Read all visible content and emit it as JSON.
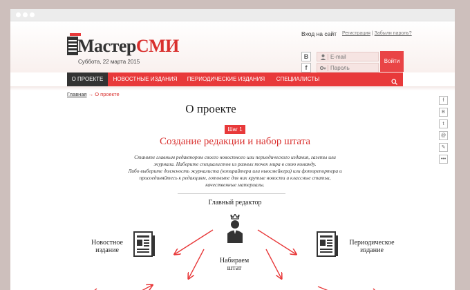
{
  "header": {
    "logo_part1": "Мастер",
    "logo_part2": "СМИ",
    "date": "Суббота, 22 марта 2015"
  },
  "login": {
    "title": "Вход на сайт",
    "register": "Регистрация",
    "separator": "|",
    "forgot": "Забыли пароль?",
    "email_placeholder": "E-mail",
    "password_placeholder": "Пароль",
    "submit": "Войти",
    "social": [
      "В",
      "f"
    ]
  },
  "nav": {
    "items": [
      "О ПРОЕКТЕ",
      "НОВОСТНЫЕ ИЗДАНИЯ",
      "ПЕРИОДИЧЕСКИЕ ИЗДАНИЯ",
      "СПЕЦИАЛИСТЫ"
    ]
  },
  "breadcrumb": {
    "home": "Главная",
    "arrow": "→",
    "current": "О проекте"
  },
  "main": {
    "title": "О проекте",
    "step_badge": "Шаг 1",
    "step_title": "Создание редакции и набор штата",
    "p1": "Станьте главным редактором своего новостного или периодического издания, газеты или журнала. Наберите специалистов из разных точек мира в свою команду.",
    "p2": "Либо выберите должность журналиста (копирайтера или ньюсмейкера) или фоторепортера и присоединяйтесь к редакциям, готовьте для них крутые новости и классные статьи, качественные материалы."
  },
  "diagram": {
    "chief": "Главный редактор",
    "news": "Новостное издание",
    "periodical": "Периодическое издание",
    "hire": "Набираем штат"
  },
  "share": [
    "f",
    "В",
    "t",
    "@",
    "✎",
    "•••"
  ],
  "colors": {
    "accent": "#e8393a",
    "dark": "#333333",
    "background": "#cdbfbc"
  }
}
